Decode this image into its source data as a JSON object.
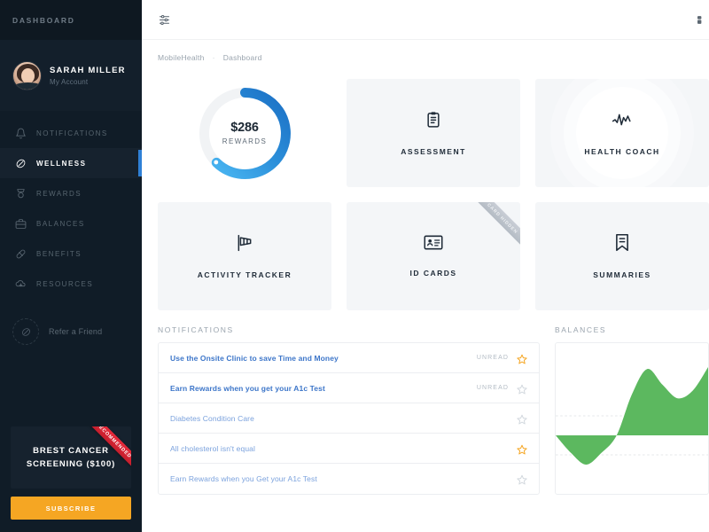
{
  "sidebar": {
    "brand": "DASHBOARD",
    "profile": {
      "name": "SARAH MILLER",
      "subtitle": "My Account",
      "avatar_icon": "user-avatar"
    },
    "items": [
      {
        "label": "NOTIFICATIONS",
        "icon": "bell-icon",
        "active": false
      },
      {
        "label": "WELLNESS",
        "icon": "leaf-icon",
        "active": true
      },
      {
        "label": "REWARDS",
        "icon": "medal-icon",
        "active": false
      },
      {
        "label": "BALANCES",
        "icon": "briefcase-icon",
        "active": false
      },
      {
        "label": "BENEFITS",
        "icon": "pill-icon",
        "active": false
      },
      {
        "label": "RESOURCES",
        "icon": "cloud-download-icon",
        "active": false
      }
    ],
    "refer": {
      "label": "Refer a Friend",
      "icon": "refer-icon"
    },
    "promo": {
      "ribbon": "RECOMMENDED",
      "title_line1": "BREST CANCER",
      "title_line2": "SCREENING ($100)",
      "button_label": "SUBSCRIBE",
      "button_color": "#f5a623",
      "ribbon_color": "#e8293a"
    },
    "active_indicator_color": "#2f80d6",
    "background_color": "#101c27"
  },
  "topbar": {
    "settings_icon": "sliders-icon",
    "right_icon": "user-menu-icon"
  },
  "breadcrumb": {
    "root": "MobileHealth",
    "separator": "·",
    "current": "Dashboard"
  },
  "tiles": [
    {
      "type": "donut",
      "amount": "$286",
      "label": "REWARDS",
      "icon": ""
    },
    {
      "type": "icon",
      "label": "ASSESSMENT",
      "icon": "clipboard-icon"
    },
    {
      "type": "icon",
      "label": "HEALTH COACH",
      "icon": "pulse-icon",
      "ripple": true
    },
    {
      "type": "icon",
      "label": "ACTIVITY TRACKER",
      "icon": "windsock-icon"
    },
    {
      "type": "icon",
      "label": "ID CARDS",
      "icon": "id-card-icon",
      "ribbon": "CARD HIDDEN"
    },
    {
      "type": "icon",
      "label": "SUMMARIES",
      "icon": "bookmark-icon"
    }
  ],
  "notifications": {
    "title": "NOTIFICATIONS",
    "unread_label": "UNREAD",
    "items": [
      {
        "text": "Use the Onsite Clinic to save Time and Money",
        "unread": true,
        "starred": true
      },
      {
        "text": "Earn Rewards when you get your A1c Test",
        "unread": true,
        "starred": false
      },
      {
        "text": "Diabetes Condition Care",
        "unread": false,
        "starred": false
      },
      {
        "text": "All cholesterol isn't equal",
        "unread": false,
        "starred": true
      },
      {
        "text": "Earn Rewards when you Get your A1c Test",
        "unread": false,
        "starred": false
      }
    ],
    "star_active_color": "#f5a623",
    "star_inactive_color": "#d2d8de"
  },
  "balances": {
    "title": "BALANCES"
  },
  "chart_data": {
    "type": "area",
    "title": "BALANCES",
    "x": [
      0,
      1,
      2,
      3,
      4,
      5,
      6,
      7,
      8,
      9,
      10
    ],
    "values": [
      0,
      -18,
      -30,
      -18,
      0,
      42,
      68,
      52,
      38,
      46,
      70
    ],
    "baseline": 0,
    "ylim": [
      -40,
      80
    ],
    "grid": true,
    "gridlines": [
      -20,
      20
    ],
    "xlabel": "",
    "ylabel": "",
    "series_color": "#5cb85f",
    "legend": "none"
  },
  "colors": {
    "accent_blue": "#3d76c9",
    "donut_blue_dark": "#1b6fc4",
    "donut_blue_light": "#3ea8e8",
    "green": "#5cb85f",
    "orange": "#f5a623",
    "tile_bg": "#f4f6f8"
  }
}
